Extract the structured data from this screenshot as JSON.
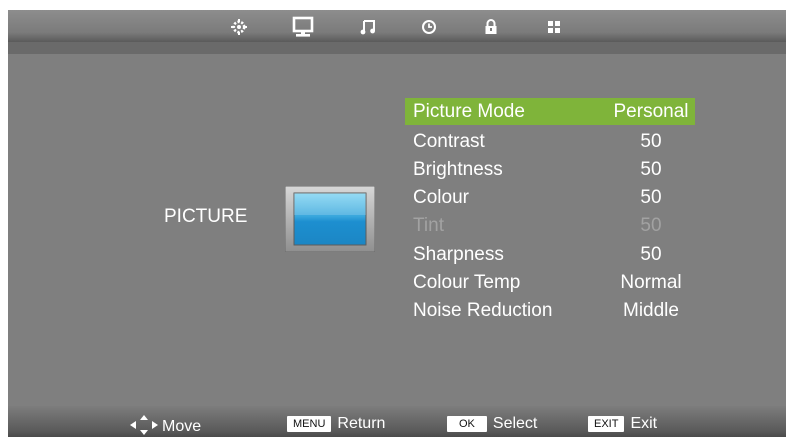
{
  "tabs": [
    {
      "icon": "gear-icon"
    },
    {
      "icon": "monitor-icon"
    },
    {
      "icon": "music-note-icon"
    },
    {
      "icon": "clock-icon"
    },
    {
      "icon": "lock-icon"
    },
    {
      "icon": "grid-icon"
    }
  ],
  "active_tab": "monitor-icon",
  "category": {
    "label": "PICTURE",
    "icon": "tv-screen-icon"
  },
  "menu": [
    {
      "label": "Picture Mode",
      "value": "Personal",
      "state": "selected"
    },
    {
      "label": "Contrast",
      "value": "50",
      "state": "normal"
    },
    {
      "label": "Brightness",
      "value": "50",
      "state": "normal"
    },
    {
      "label": "Colour",
      "value": "50",
      "state": "normal"
    },
    {
      "label": "Tint",
      "value": "50",
      "state": "disabled"
    },
    {
      "label": "Sharpness",
      "value": "50",
      "state": "normal"
    },
    {
      "label": "Colour Temp",
      "value": "Normal",
      "state": "normal"
    },
    {
      "label": "Noise Reduction",
      "value": "Middle",
      "state": "normal"
    }
  ],
  "hints": {
    "move": "Move",
    "menu_key": "MENU",
    "return": "Return",
    "ok_key": "OK",
    "select": "Select",
    "exit_key": "EXIT",
    "exit": "Exit"
  },
  "colors": {
    "highlight": "#7fb43a",
    "background": "#7f7f7f",
    "disabled_text": "#a2a2a2"
  }
}
